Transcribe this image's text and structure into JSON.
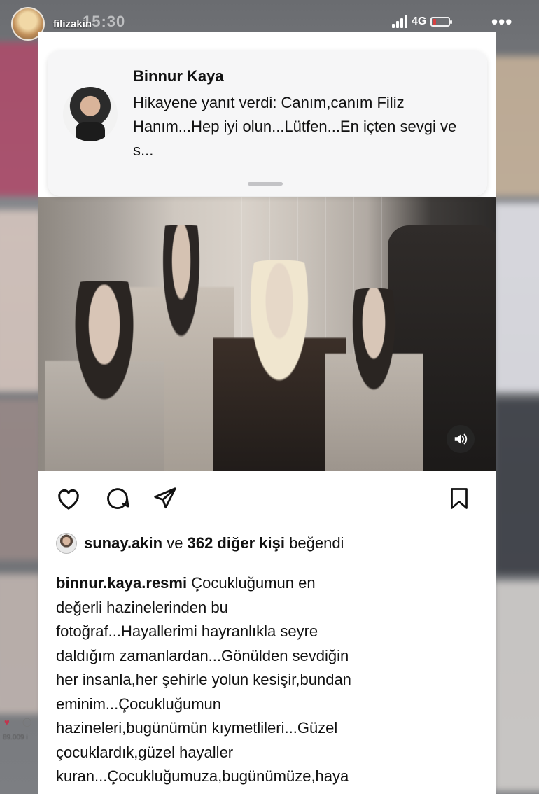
{
  "story": {
    "username": "filizakin",
    "time": "15:30",
    "network": "4G",
    "signal_bars": 4,
    "battery_level": 0.2
  },
  "notification": {
    "sender_name": "Binnur Kaya",
    "message": "Hikayene yanıt verdi: Canım,canım Filiz Hanım...Hep iyi olun...Lütfen...En içten sevgi ve s..."
  },
  "post": {
    "likes": {
      "user": "sunay.akin",
      "connector": "ve",
      "count_text": "362 diğer kişi",
      "suffix": "beğendi"
    },
    "caption": {
      "author": "binnur.kaya.resmi",
      "text": "Çocukluğumun en\ndeğerli hazinelerinden bu\nfotoğraf...Hayallerimi hayranlıkla seyre\ndaldığım zamanlardan...Gönülden sevdiğin\nher insanla,her şehirle yolun kesişir,bundan\neminim...Çocukluğumun\nhazineleri,bugünümün kıymetlileri...Güzel\nçocuklardık,güzel hayaller\nkuran...Çocukluğumuza,bugünümüze,haya\nllerimize selam olsun..."
    }
  },
  "background": {
    "side_count": "89.009 i"
  },
  "icons": {
    "like": "heart-icon",
    "comment": "comment-icon",
    "share": "send-icon",
    "save": "bookmark-icon",
    "sound": "speaker-icon",
    "more": "more-icon"
  },
  "colors": {
    "battery_low": "#e23b3b",
    "text": "#111111",
    "card": "#ffffff"
  }
}
